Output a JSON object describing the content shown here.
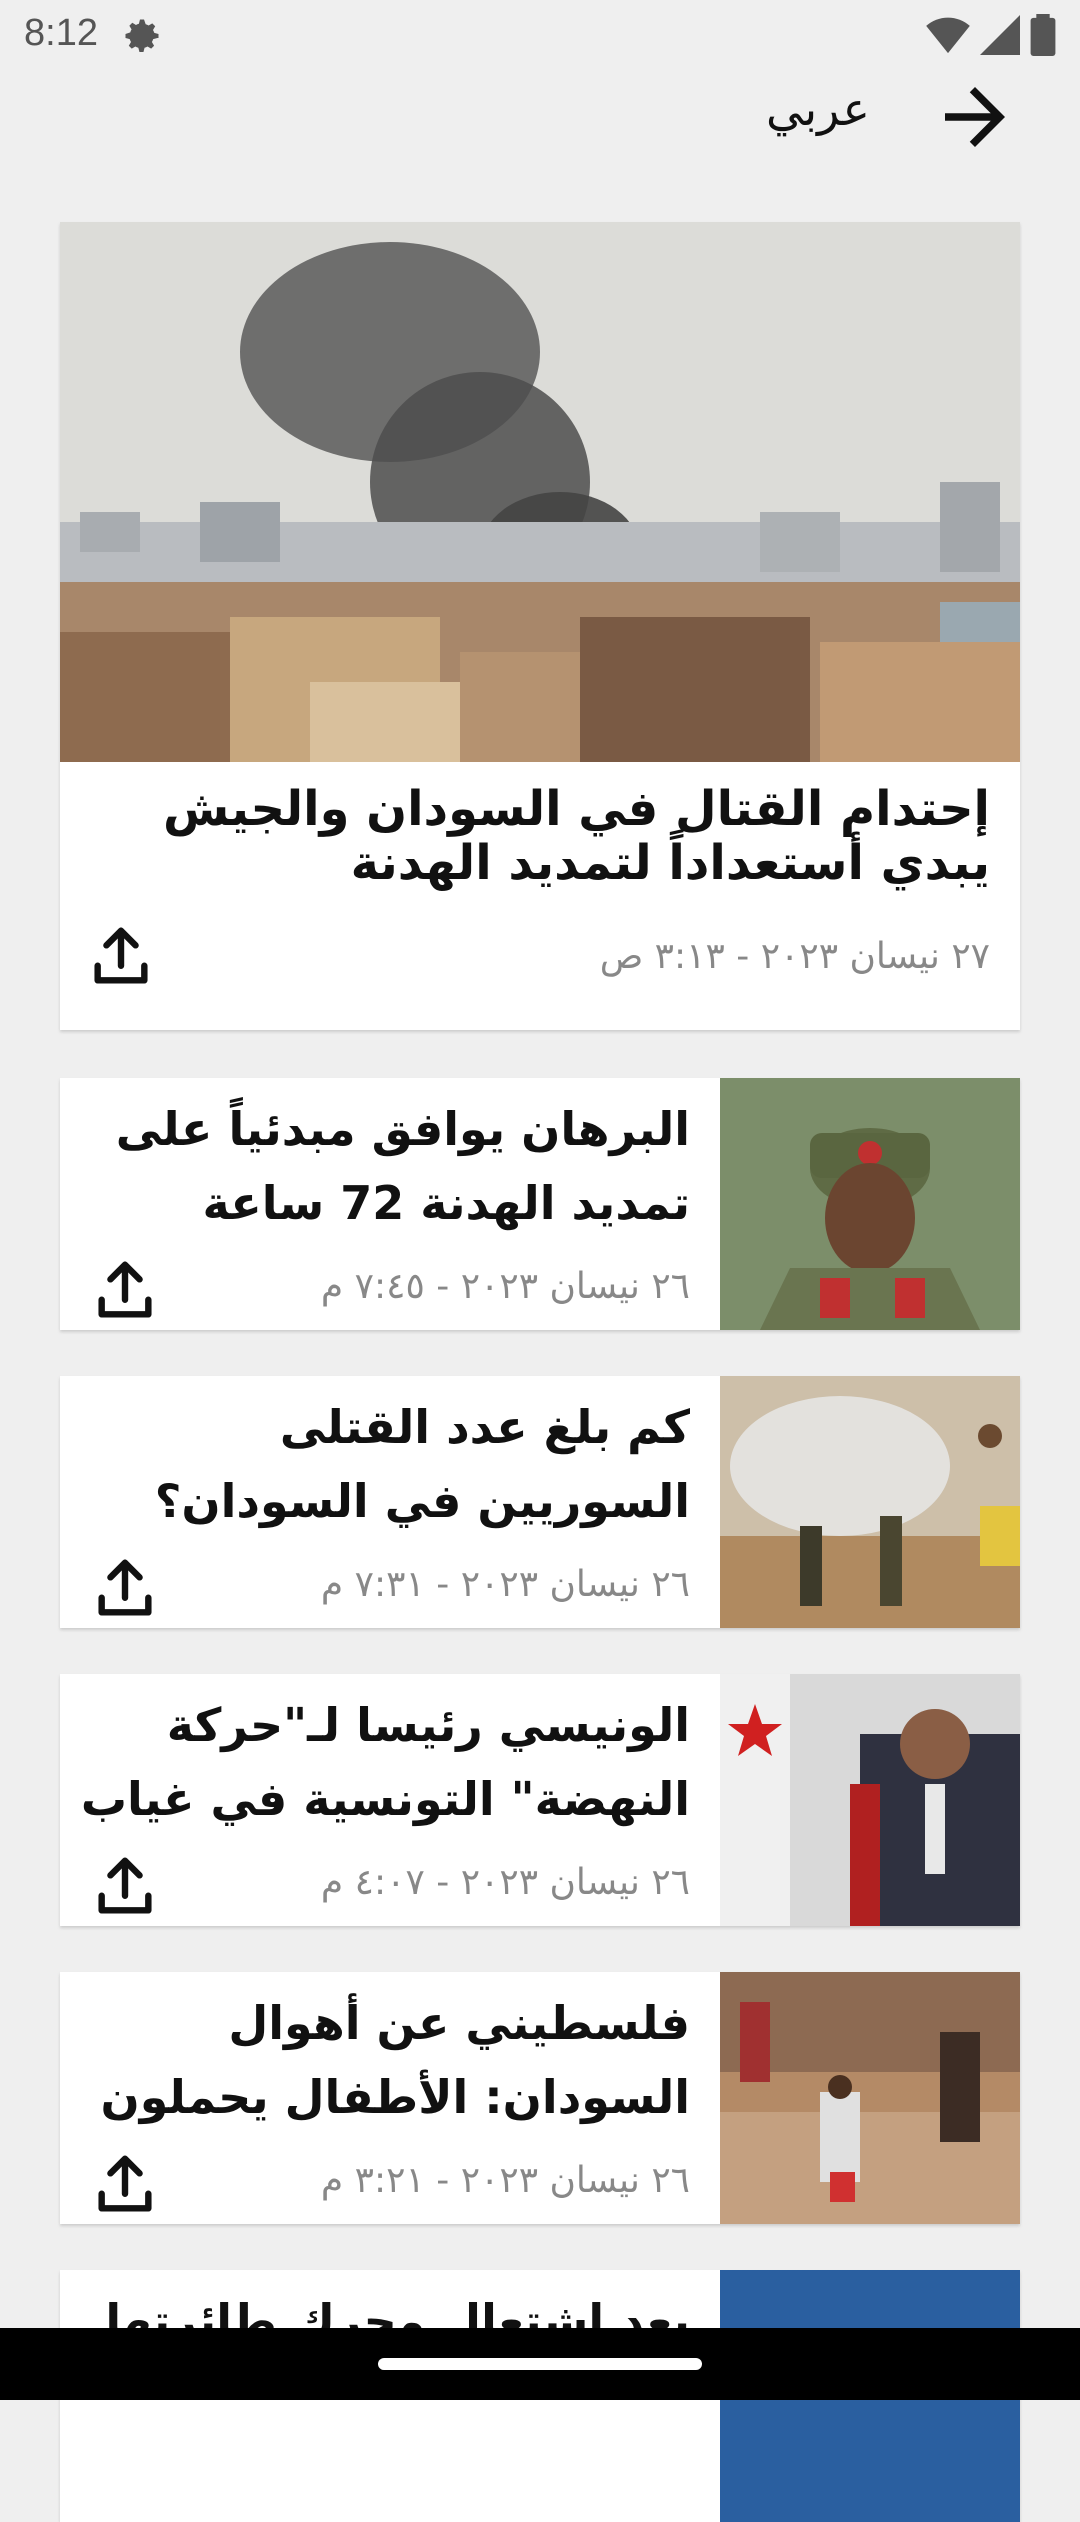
{
  "status_bar": {
    "time": "8:12"
  },
  "header": {
    "title": "عربي"
  },
  "featured": {
    "headline": "إحتدام القتال في السودان والجيش يبدي أستعداداً لتمديد الهدنة",
    "date": "٢٧ نيسان ٢٠٢٣ - ٣:١٣ ص",
    "image_icon": "smoke-over-city-photo"
  },
  "articles": [
    {
      "headline": "البرهان يوافق مبدئياً على تمديد الهدنة 72 ساعة",
      "date": "٢٦ نيسان ٢٠٢٣ - ٧:٤٥ م"
    },
    {
      "headline": "كم بلغ عدد القتلى السوريين في السودان؟",
      "date": "٢٦ نيسان ٢٠٢٣ - ٧:٣١ م"
    },
    {
      "headline": "الونيسي رئيسا لـ\"حركة النهضة\" التونسية في غياب",
      "date": "٢٦ نيسان ٢٠٢٣ - ٤:٠٧ م"
    },
    {
      "headline": "فلسطيني عن أهوال السودان: الأطفال يحملون",
      "date": "٢٦ نيسان ٢٠٢٣ - ٣:٢١ م"
    },
    {
      "headline": "بعد اشتعال محرك طائرتها",
      "date": ""
    }
  ],
  "colors": {
    "background": "#efefef",
    "card": "#ffffff",
    "date_text": "#888888",
    "nav_bar": "#000000"
  }
}
